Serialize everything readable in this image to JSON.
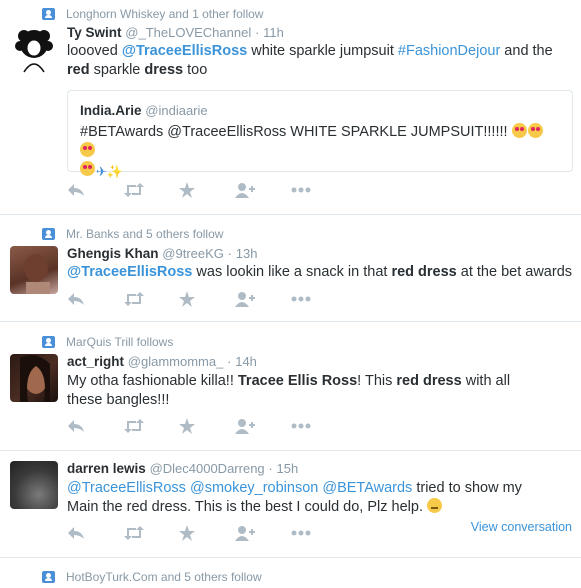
{
  "tweets": [
    {
      "context": "Longhorn Whiskey and 1 other follow",
      "name": "Ty Swint",
      "handle": "@_TheLOVEChannel",
      "dot": "·",
      "time": "11h",
      "text_parts": {
        "p1": "loooved ",
        "mention1": "@TraceeEllisRoss",
        "p2": "  white sparkle jumpsuit ",
        "hashtag1": "#FashionDejour",
        "p3": " and the ",
        "hl1": "red",
        "p4": " sparkle ",
        "hl2": "dress",
        "p5": " too"
      },
      "quote": {
        "name": "India.Arie",
        "handle": "@indiaarie",
        "text": "#BETAwards @TraceeEllisRoss WHITE SPARKLE JUMPSUIT!!!!!! "
      }
    },
    {
      "context": "Mr. Banks and 5 others follow",
      "name": "Ghengis Khan",
      "handle": "@9treeKG",
      "dot": "·",
      "time": "13h",
      "text_parts": {
        "mention1": "@TraceeEllisRoss",
        "p1": " was lookin like a snack in that ",
        "hl1": "red dress",
        "p2": " at the bet awards"
      }
    },
    {
      "context": "MarQuis Trill follows",
      "name": "act_right",
      "handle": "@glammomma_",
      "dot": "·",
      "time": "14h",
      "text_parts": {
        "p1": "My otha fashionable killa!! ",
        "hl1": "Tracee Ellis Ross",
        "p2": "! This ",
        "hl2": "red dress",
        "p3": " with all these bangles!!!"
      }
    },
    {
      "name": "darren lewis",
      "handle": "@Dlec4000Darreng",
      "dot": "·",
      "time": "15h",
      "text_parts": {
        "mention1": "@TraceeEllisRoss",
        "sp1": " ",
        "mention2": "@smokey_robinson",
        "sp2": " ",
        "mention3": "@BETAwards",
        "p1": " tried to show my Main the red dress. This is the best I  could do, Plz help. "
      },
      "view_conversation": "View conversation"
    },
    {
      "context": "HotBoyTurk.Com and 5 others follow"
    }
  ],
  "icons": [
    "reply-icon",
    "retweet-icon",
    "favorite-icon",
    "follow-icon",
    "more-icon"
  ],
  "colors": {
    "link": "#3b94d9",
    "muted": "#8899a6",
    "border": "#e1e8ed",
    "action": "#b0bcc5"
  }
}
